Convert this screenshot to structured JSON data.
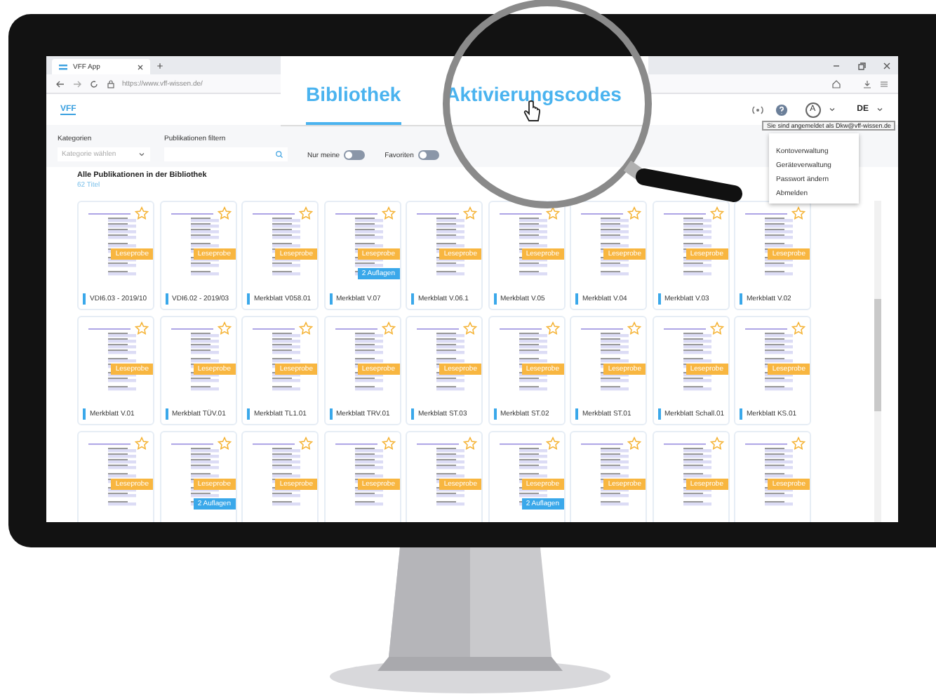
{
  "browser": {
    "tab_title": "VFF App",
    "url": "https://www.vff-wissen.de/"
  },
  "app": {
    "logo": "VFF",
    "language": "DE",
    "avatar": "A"
  },
  "tabs": [
    {
      "label": "Bibliothek",
      "selected": true
    },
    {
      "label": "Aktivierungscodes",
      "selected": false
    }
  ],
  "filters": {
    "category_label": "Kategorien",
    "category_placeholder": "Kategorie wählen",
    "filter_label": "Publikationen filtern",
    "toggles": [
      {
        "label": "Nur meine",
        "on": false
      },
      {
        "label": "Favoriten",
        "on": false
      }
    ]
  },
  "user_menu": {
    "tooltip": "Sie sind angemeldet als Dkw@vff-wissen.de",
    "items": [
      "Kontoverwaltung",
      "Geräteverwaltung",
      "Passwort ändern",
      "Abmelden"
    ]
  },
  "library": {
    "heading": "Alle Publikationen in der Bibliothek",
    "count": "62 Titel",
    "cards": [
      {
        "title": "VDI6.03 - 2019/10",
        "badge": "Leseprobe"
      },
      {
        "title": "VDI6.02 - 2019/03",
        "badge": "Leseprobe"
      },
      {
        "title": "Merkblatt V058.01",
        "badge": "Leseprobe"
      },
      {
        "title": "Merkblatt V.07",
        "badge": "Leseprobe",
        "editions": "2 Auflagen"
      },
      {
        "title": "Merkblatt V.06.1",
        "badge": "Leseprobe"
      },
      {
        "title": "Merkblatt V.05",
        "badge": "Leseprobe"
      },
      {
        "title": "Merkblatt V.04",
        "badge": "Leseprobe"
      },
      {
        "title": "Merkblatt V.03",
        "badge": "Leseprobe"
      },
      {
        "title": "Merkblatt V.02",
        "badge": "Leseprobe"
      },
      {
        "title": "Merkblatt V.01",
        "badge": "Leseprobe"
      },
      {
        "title": "Merkblatt TÜV.01",
        "badge": "Leseprobe"
      },
      {
        "title": "Merkblatt TL1.01",
        "badge": "Leseprobe"
      },
      {
        "title": "Merkblatt TRV.01",
        "badge": "Leseprobe"
      },
      {
        "title": "Merkblatt ST.03",
        "badge": "Leseprobe"
      },
      {
        "title": "Merkblatt ST.02",
        "badge": "Leseprobe"
      },
      {
        "title": "Merkblatt ST.01",
        "badge": "Leseprobe"
      },
      {
        "title": "Merkblatt Schall.01",
        "badge": "Leseprobe"
      },
      {
        "title": "Merkblatt KS.01",
        "badge": "Leseprobe"
      },
      {
        "badge": "Leseprobe"
      },
      {
        "badge": "Leseprobe",
        "editions": "2 Auflagen"
      },
      {
        "badge": "Leseprobe"
      },
      {
        "badge": "Leseprobe"
      },
      {
        "badge": "Leseprobe"
      },
      {
        "badge": "Leseprobe",
        "editions": "2 Auflagen"
      },
      {
        "badge": "Leseprobe"
      },
      {
        "badge": "Leseprobe"
      },
      {
        "badge": "Leseprobe"
      }
    ]
  }
}
